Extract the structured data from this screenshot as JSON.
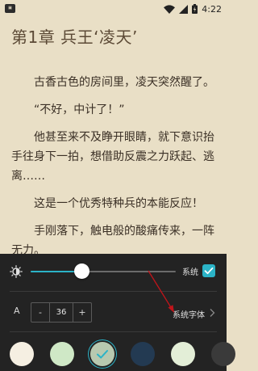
{
  "status_bar": {
    "time": "4:22",
    "icons": [
      "app-icon",
      "wifi-icon",
      "signal-icon",
      "battery-icon"
    ]
  },
  "chapter": {
    "title": "第1章 兵王‘凌天’",
    "paragraphs": [
      "古香古色的房间里，凌天突然醒了。",
      "“不好，中计了！”",
      "他甚至来不及睁开眼睛，就下意识抬手往身下一拍，想借助反震之力跃起、逃离……",
      "这是一个优秀特种兵的本能反应！",
      "手刚落下，触电般的酸痛传来，一阵无力。"
    ]
  },
  "settings": {
    "brightness_level": 0.35,
    "system_brightness_label": "系统",
    "system_brightness_checked": true,
    "font_size_label": "A",
    "decrease_label": "-",
    "font_size_value": "36",
    "increase_label": "+",
    "font_typeface_label": "系统字体",
    "accent_color": "#2bb3c7",
    "themes": [
      {
        "color": "#f5efe2",
        "selected": false
      },
      {
        "color": "#cfe8c6",
        "selected": false
      },
      {
        "color": "#b8c9b0",
        "selected": true
      },
      {
        "color": "#233a52",
        "selected": false
      },
      {
        "color": "#e3eed7",
        "selected": false
      },
      {
        "color": "#3a3a3a",
        "selected": false
      }
    ]
  }
}
